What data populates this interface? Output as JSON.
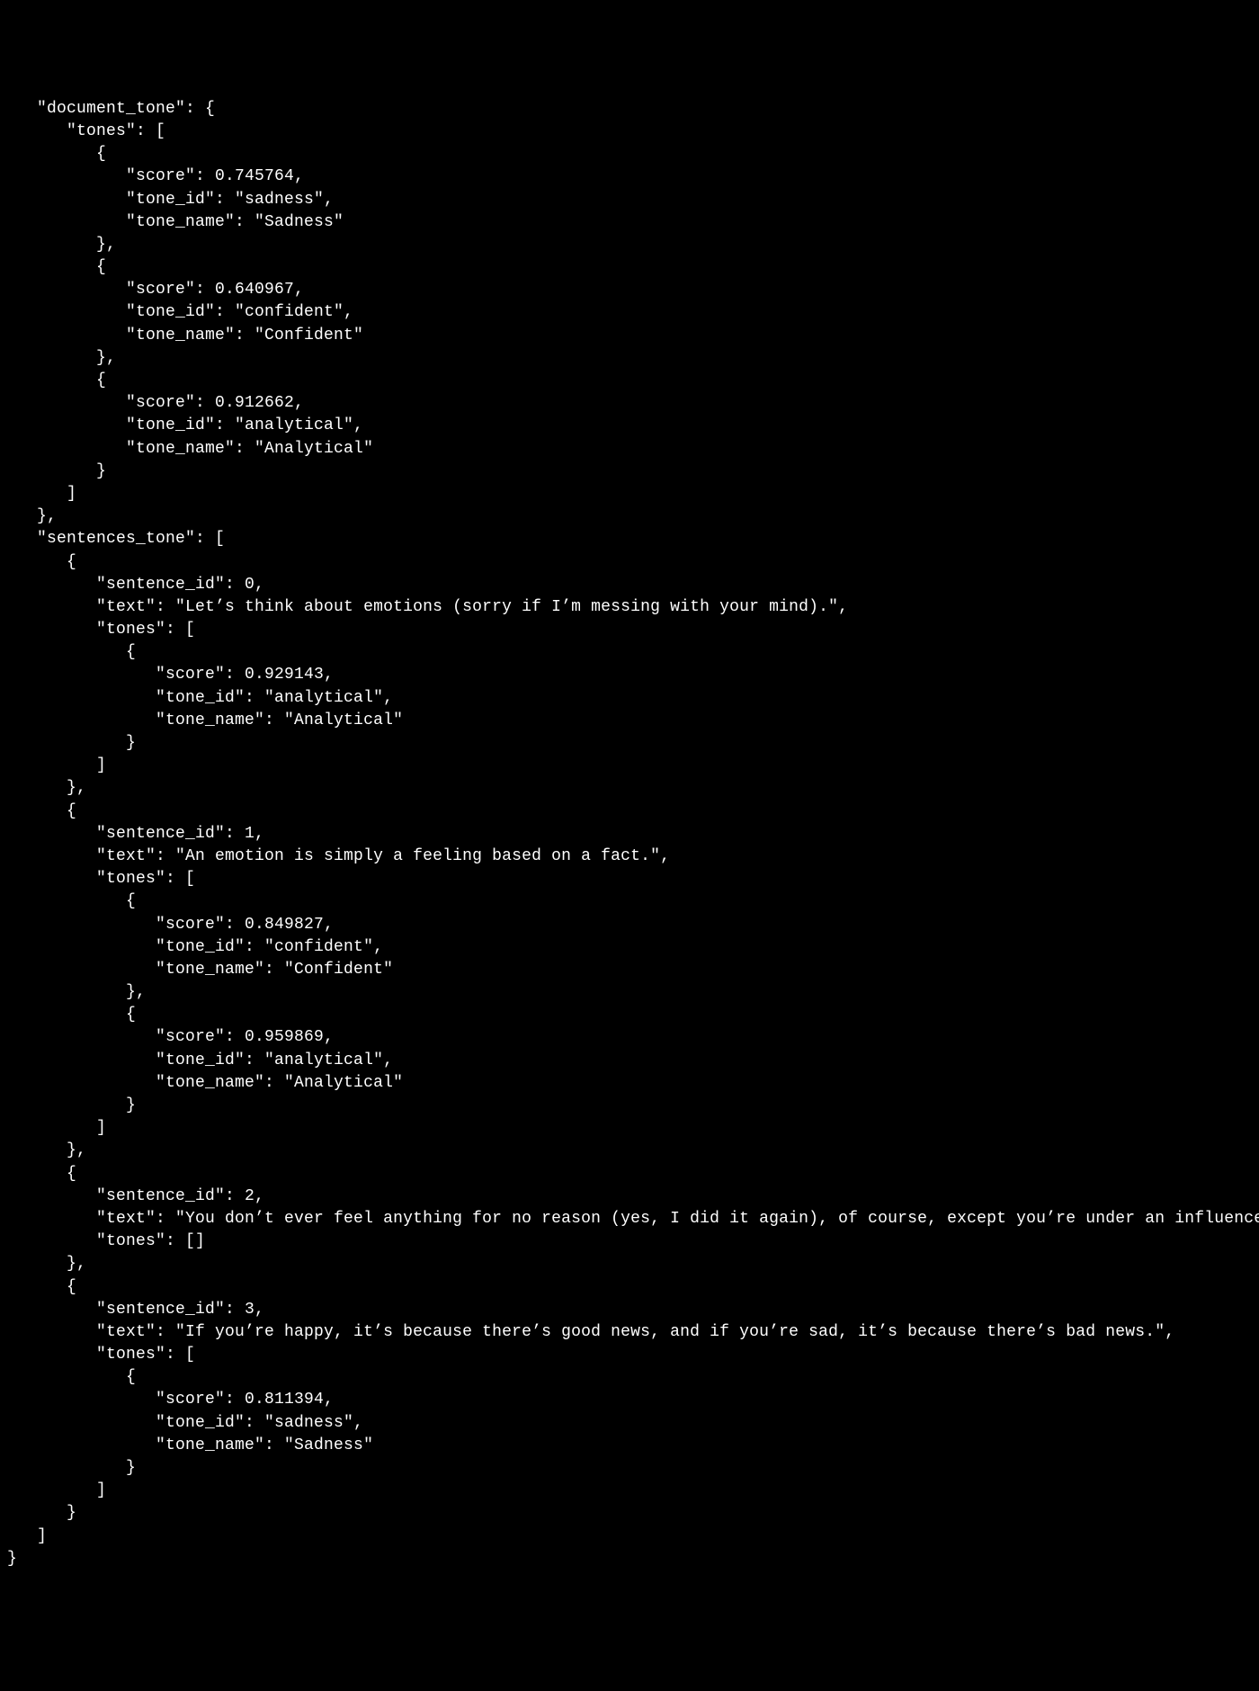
{
  "json_payload": {
    "document_tone": {
      "tones": [
        {
          "score": 0.745764,
          "tone_id": "sadness",
          "tone_name": "Sadness"
        },
        {
          "score": 0.640967,
          "tone_id": "confident",
          "tone_name": "Confident"
        },
        {
          "score": 0.912662,
          "tone_id": "analytical",
          "tone_name": "Analytical"
        }
      ]
    },
    "sentences_tone": [
      {
        "sentence_id": 0,
        "text": "Let's think about emotions (sorry if I'm messing with your mind).",
        "tones": [
          {
            "score": 0.929143,
            "tone_id": "analytical",
            "tone_name": "Analytical"
          }
        ]
      },
      {
        "sentence_id": 1,
        "text": "An emotion is simply a feeling based on a fact.",
        "tones": [
          {
            "score": 0.849827,
            "tone_id": "confident",
            "tone_name": "Confident"
          },
          {
            "score": 0.959869,
            "tone_id": "analytical",
            "tone_name": "Analytical"
          }
        ]
      },
      {
        "sentence_id": 2,
        "text": "You don't ever feel anything for no reason (yes, I did it again), of course, except you're under an influence.",
        "tones": []
      },
      {
        "sentence_id": 3,
        "text": "If you're happy, it's because there's good news, and if you're sad, it's because there's bad news.",
        "tones": [
          {
            "score": 0.811394,
            "tone_id": "sadness",
            "tone_name": "Sadness"
          }
        ]
      }
    ]
  }
}
